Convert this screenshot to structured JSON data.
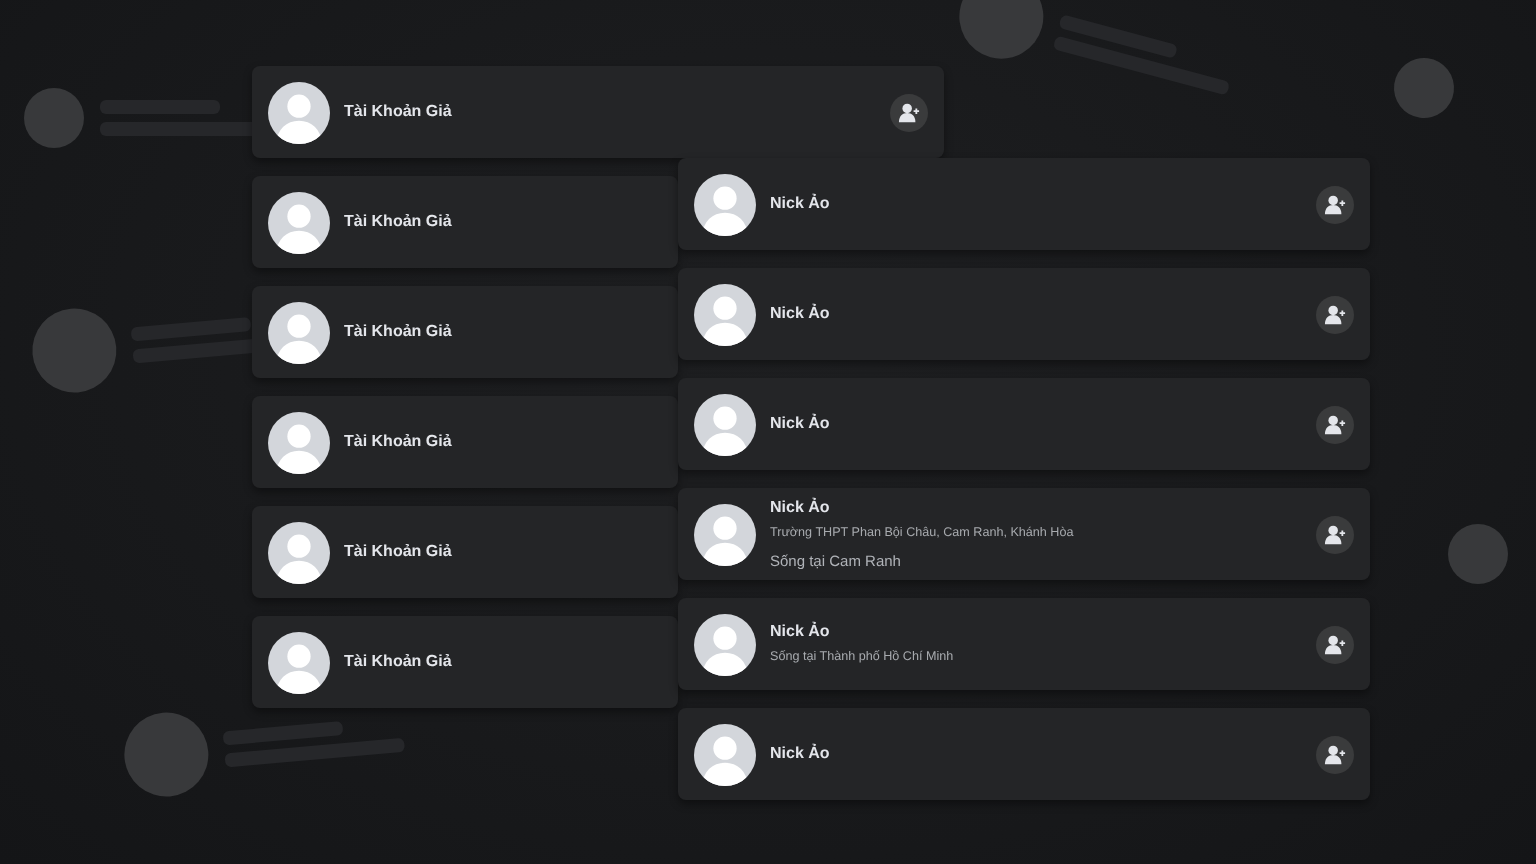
{
  "fake_accounts": [
    {
      "name": "Tài Khoản Giả",
      "add_button": true
    },
    {
      "name": "Tài Khoản Giả",
      "add_button": false
    },
    {
      "name": "Tài Khoản Giả",
      "add_button": false
    },
    {
      "name": "Tài Khoản Giả",
      "add_button": false
    },
    {
      "name": "Tài Khoản Giả",
      "add_button": false
    },
    {
      "name": "Tài Khoản Giả",
      "add_button": false
    }
  ],
  "ghost_accounts": [
    {
      "name": "Nick Ảo"
    },
    {
      "name": "Nick Ảo"
    },
    {
      "name": "Nick Ảo"
    },
    {
      "name": "Nick Ảo",
      "details": [
        {
          "kind": "school",
          "text": "Trường THPT Phan Bội Châu, Cam Ranh, Khánh Hòa"
        },
        {
          "kind": "home",
          "text": "Sống tại Cam Ranh"
        }
      ]
    },
    {
      "name": "Nick Ảo",
      "details": [
        {
          "kind": "school",
          "text": "Sống tại Thành phố Hồ Chí Minh"
        }
      ]
    },
    {
      "name": "Nick Ảo"
    }
  ]
}
